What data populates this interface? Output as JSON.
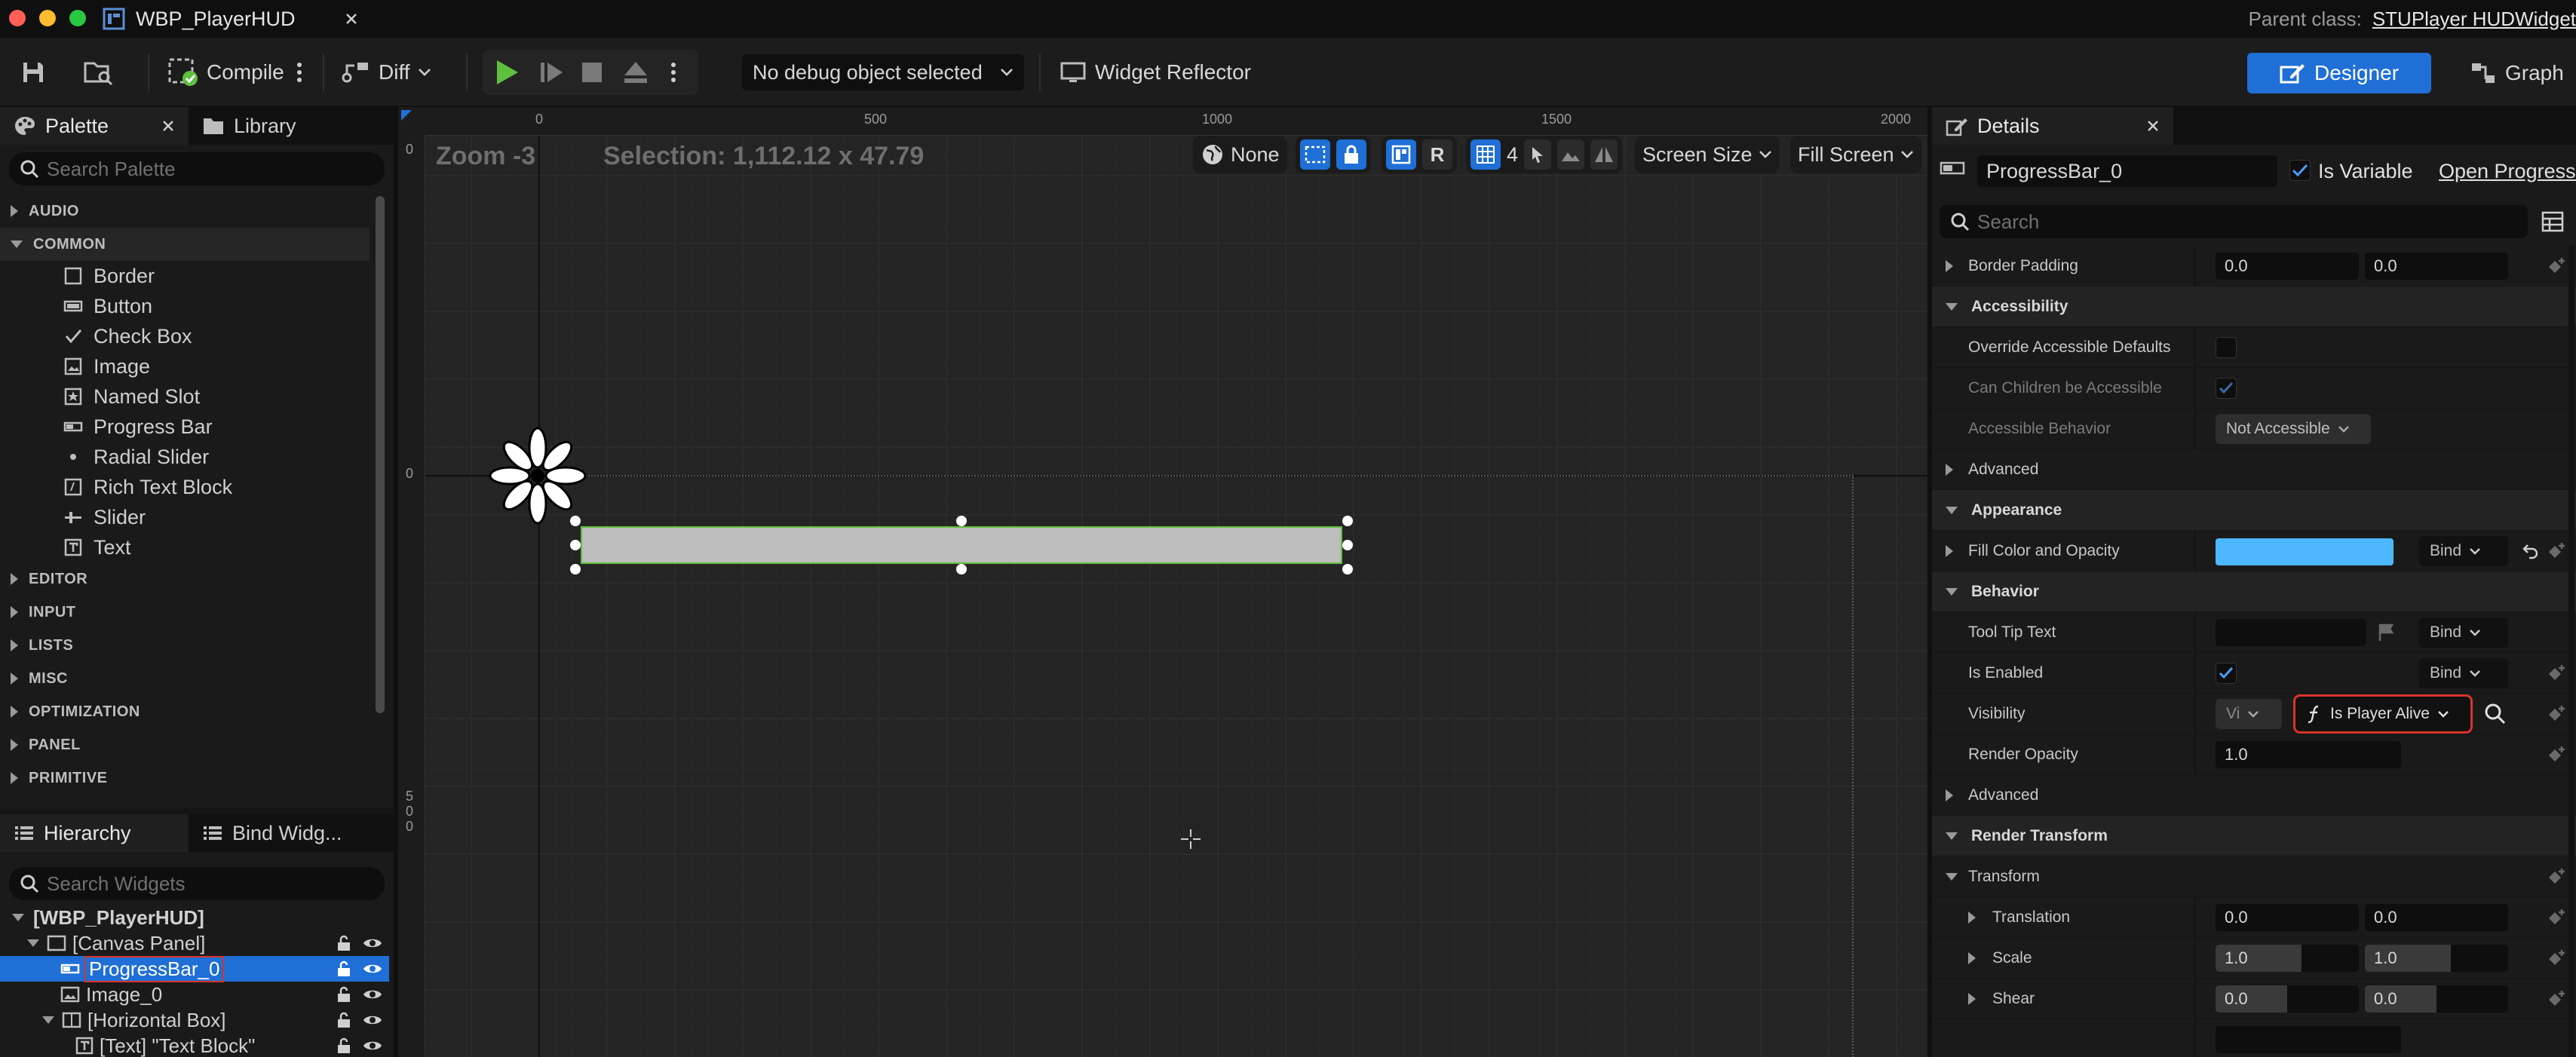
{
  "window": {
    "tab_title": "WBP_PlayerHUD",
    "parent_class_label": "Parent class:",
    "parent_class_value": "STUPlayer HUDWidget"
  },
  "toolbar": {
    "compile_label": "Compile",
    "diff_label": "Diff",
    "debug_object": "No debug object selected",
    "widget_reflector_label": "Widget Reflector",
    "designer_label": "Designer",
    "graph_label": "Graph"
  },
  "palette": {
    "tab_label": "Palette",
    "library_tab_label": "Library",
    "search_placeholder": "Search Palette",
    "categories_top": [
      "AUDIO",
      "COMMON"
    ],
    "common_items": [
      "Border",
      "Button",
      "Check Box",
      "Image",
      "Named Slot",
      "Progress Bar",
      "Radial Slider",
      "Rich Text Block",
      "Slider",
      "Text"
    ],
    "categories_bottom": [
      "EDITOR",
      "INPUT",
      "LISTS",
      "MISC",
      "OPTIMIZATION",
      "PANEL",
      "PRIMITIVE"
    ]
  },
  "hierarchy": {
    "tab_label": "Hierarchy",
    "bind_tab_label": "Bind Widg...",
    "search_placeholder": "Search Widgets",
    "rows": [
      "[WBP_PlayerHUD]",
      "[Canvas Panel]",
      "ProgressBar_0",
      "Image_0",
      "[Horizontal Box]",
      "[Text] \"Text Block\""
    ]
  },
  "viewport": {
    "zoom_text": "Zoom -3",
    "selection_text": "Selection: 1,112.12 x 47.79",
    "ruler_top_labels": [
      "0",
      "500",
      "1000",
      "1500",
      "2000"
    ],
    "ruler_left_labels": [
      "0",
      "0",
      "5",
      "0",
      "0"
    ],
    "none_label": "None",
    "r_label": "R",
    "grid_count": "4",
    "screen_size_label": "Screen Size",
    "fill_screen_label": "Fill Screen"
  },
  "details": {
    "tab_label": "Details",
    "widget_name": "ProgressBar_0",
    "is_variable_label": "Is Variable",
    "open_link": "Open ProgressBar",
    "search_placeholder": "Search",
    "border_padding_label": "Border Padding",
    "border_padding_x": "0.0",
    "border_padding_y": "0.0",
    "accessibility_section": "Accessibility",
    "override_accessible_label": "Override Accessible Defaults",
    "can_children_label": "Can Children be Accessible",
    "accessible_behavior_label": "Accessible Behavior",
    "accessible_behavior_value": "Not Accessible",
    "advanced_label": "Advanced",
    "appearance_section": "Appearance",
    "fill_color_label": "Fill Color and Opacity",
    "fill_color_hex": "#4db8ff",
    "bind_label": "Bind",
    "behavior_section": "Behavior",
    "tool_tip_label": "Tool Tip Text",
    "is_enabled_label": "Is Enabled",
    "visibility_label": "Visibility",
    "visibility_value": "Vi",
    "visibility_binding": "Is Player Alive",
    "render_opacity_label": "Render Opacity",
    "render_opacity_value": "1.0",
    "advanced2_label": "Advanced",
    "render_transform_section": "Render Transform",
    "transform_label": "Transform",
    "translation_label": "Translation",
    "translation_x": "0.0",
    "translation_y": "0.0",
    "scale_label": "Scale",
    "scale_x": "1.0",
    "scale_y": "1.0",
    "shear_label": "Shear",
    "shear_x": "0.0",
    "shear_y": "0.0"
  },
  "colors": {
    "accent": "#1f6fd6",
    "highlight_red": "#d9342b",
    "progress_fill": "#bdbdbd",
    "selection_green": "#5fbf3f"
  }
}
